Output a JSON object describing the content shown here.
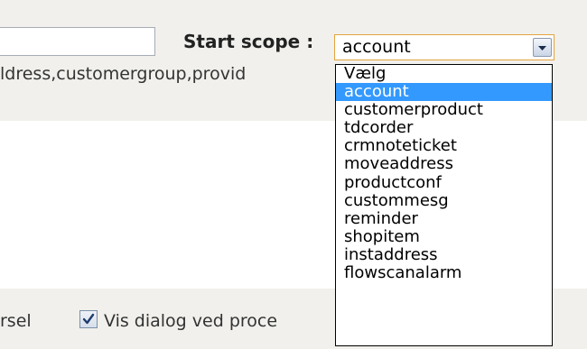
{
  "scope": {
    "label": "Start scope :",
    "scope_list_text": "ldress,customergroup,provid",
    "select": {
      "value": "account",
      "options": [
        "Vælg",
        "account",
        "customerproduct",
        "tdcorder",
        "crmnoteticket",
        "moveaddress",
        "productconf",
        "custommesg",
        "reminder",
        "shopitem",
        "instaddress",
        "flowscanalarm"
      ],
      "selected_index": 1
    }
  },
  "footer": {
    "left_text": "rsel",
    "checkbox_checked": true,
    "checkbox_label": "Vis dialog ved proce"
  },
  "colors": {
    "panel_bg": "#f1f0ec",
    "select_border": "#e4a43e",
    "selected_option_bg": "#3399ff"
  },
  "icons": {
    "select_arrow": "chevron-down-icon",
    "checkbox_mark": "checkmark-icon"
  }
}
